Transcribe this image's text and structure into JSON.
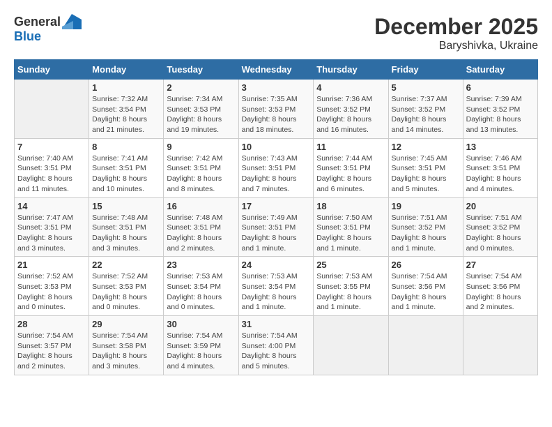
{
  "header": {
    "logo": {
      "general": "General",
      "blue": "Blue"
    },
    "title": "December 2025",
    "location": "Baryshivka, Ukraine"
  },
  "calendar": {
    "days_of_week": [
      "Sunday",
      "Monday",
      "Tuesday",
      "Wednesday",
      "Thursday",
      "Friday",
      "Saturday"
    ],
    "weeks": [
      [
        {
          "day": "",
          "info": ""
        },
        {
          "day": "1",
          "info": "Sunrise: 7:32 AM\nSunset: 3:54 PM\nDaylight: 8 hours\nand 21 minutes."
        },
        {
          "day": "2",
          "info": "Sunrise: 7:34 AM\nSunset: 3:53 PM\nDaylight: 8 hours\nand 19 minutes."
        },
        {
          "day": "3",
          "info": "Sunrise: 7:35 AM\nSunset: 3:53 PM\nDaylight: 8 hours\nand 18 minutes."
        },
        {
          "day": "4",
          "info": "Sunrise: 7:36 AM\nSunset: 3:52 PM\nDaylight: 8 hours\nand 16 minutes."
        },
        {
          "day": "5",
          "info": "Sunrise: 7:37 AM\nSunset: 3:52 PM\nDaylight: 8 hours\nand 14 minutes."
        },
        {
          "day": "6",
          "info": "Sunrise: 7:39 AM\nSunset: 3:52 PM\nDaylight: 8 hours\nand 13 minutes."
        }
      ],
      [
        {
          "day": "7",
          "info": "Sunrise: 7:40 AM\nSunset: 3:51 PM\nDaylight: 8 hours\nand 11 minutes."
        },
        {
          "day": "8",
          "info": "Sunrise: 7:41 AM\nSunset: 3:51 PM\nDaylight: 8 hours\nand 10 minutes."
        },
        {
          "day": "9",
          "info": "Sunrise: 7:42 AM\nSunset: 3:51 PM\nDaylight: 8 hours\nand 8 minutes."
        },
        {
          "day": "10",
          "info": "Sunrise: 7:43 AM\nSunset: 3:51 PM\nDaylight: 8 hours\nand 7 minutes."
        },
        {
          "day": "11",
          "info": "Sunrise: 7:44 AM\nSunset: 3:51 PM\nDaylight: 8 hours\nand 6 minutes."
        },
        {
          "day": "12",
          "info": "Sunrise: 7:45 AM\nSunset: 3:51 PM\nDaylight: 8 hours\nand 5 minutes."
        },
        {
          "day": "13",
          "info": "Sunrise: 7:46 AM\nSunset: 3:51 PM\nDaylight: 8 hours\nand 4 minutes."
        }
      ],
      [
        {
          "day": "14",
          "info": "Sunrise: 7:47 AM\nSunset: 3:51 PM\nDaylight: 8 hours\nand 3 minutes."
        },
        {
          "day": "15",
          "info": "Sunrise: 7:48 AM\nSunset: 3:51 PM\nDaylight: 8 hours\nand 3 minutes."
        },
        {
          "day": "16",
          "info": "Sunrise: 7:48 AM\nSunset: 3:51 PM\nDaylight: 8 hours\nand 2 minutes."
        },
        {
          "day": "17",
          "info": "Sunrise: 7:49 AM\nSunset: 3:51 PM\nDaylight: 8 hours\nand 1 minute."
        },
        {
          "day": "18",
          "info": "Sunrise: 7:50 AM\nSunset: 3:51 PM\nDaylight: 8 hours\nand 1 minute."
        },
        {
          "day": "19",
          "info": "Sunrise: 7:51 AM\nSunset: 3:52 PM\nDaylight: 8 hours\nand 1 minute."
        },
        {
          "day": "20",
          "info": "Sunrise: 7:51 AM\nSunset: 3:52 PM\nDaylight: 8 hours\nand 0 minutes."
        }
      ],
      [
        {
          "day": "21",
          "info": "Sunrise: 7:52 AM\nSunset: 3:53 PM\nDaylight: 8 hours\nand 0 minutes."
        },
        {
          "day": "22",
          "info": "Sunrise: 7:52 AM\nSunset: 3:53 PM\nDaylight: 8 hours\nand 0 minutes."
        },
        {
          "day": "23",
          "info": "Sunrise: 7:53 AM\nSunset: 3:54 PM\nDaylight: 8 hours\nand 0 minutes."
        },
        {
          "day": "24",
          "info": "Sunrise: 7:53 AM\nSunset: 3:54 PM\nDaylight: 8 hours\nand 1 minute."
        },
        {
          "day": "25",
          "info": "Sunrise: 7:53 AM\nSunset: 3:55 PM\nDaylight: 8 hours\nand 1 minute."
        },
        {
          "day": "26",
          "info": "Sunrise: 7:54 AM\nSunset: 3:56 PM\nDaylight: 8 hours\nand 1 minute."
        },
        {
          "day": "27",
          "info": "Sunrise: 7:54 AM\nSunset: 3:56 PM\nDaylight: 8 hours\nand 2 minutes."
        }
      ],
      [
        {
          "day": "28",
          "info": "Sunrise: 7:54 AM\nSunset: 3:57 PM\nDaylight: 8 hours\nand 2 minutes."
        },
        {
          "day": "29",
          "info": "Sunrise: 7:54 AM\nSunset: 3:58 PM\nDaylight: 8 hours\nand 3 minutes."
        },
        {
          "day": "30",
          "info": "Sunrise: 7:54 AM\nSunset: 3:59 PM\nDaylight: 8 hours\nand 4 minutes."
        },
        {
          "day": "31",
          "info": "Sunrise: 7:54 AM\nSunset: 4:00 PM\nDaylight: 8 hours\nand 5 minutes."
        },
        {
          "day": "",
          "info": ""
        },
        {
          "day": "",
          "info": ""
        },
        {
          "day": "",
          "info": ""
        }
      ]
    ]
  }
}
